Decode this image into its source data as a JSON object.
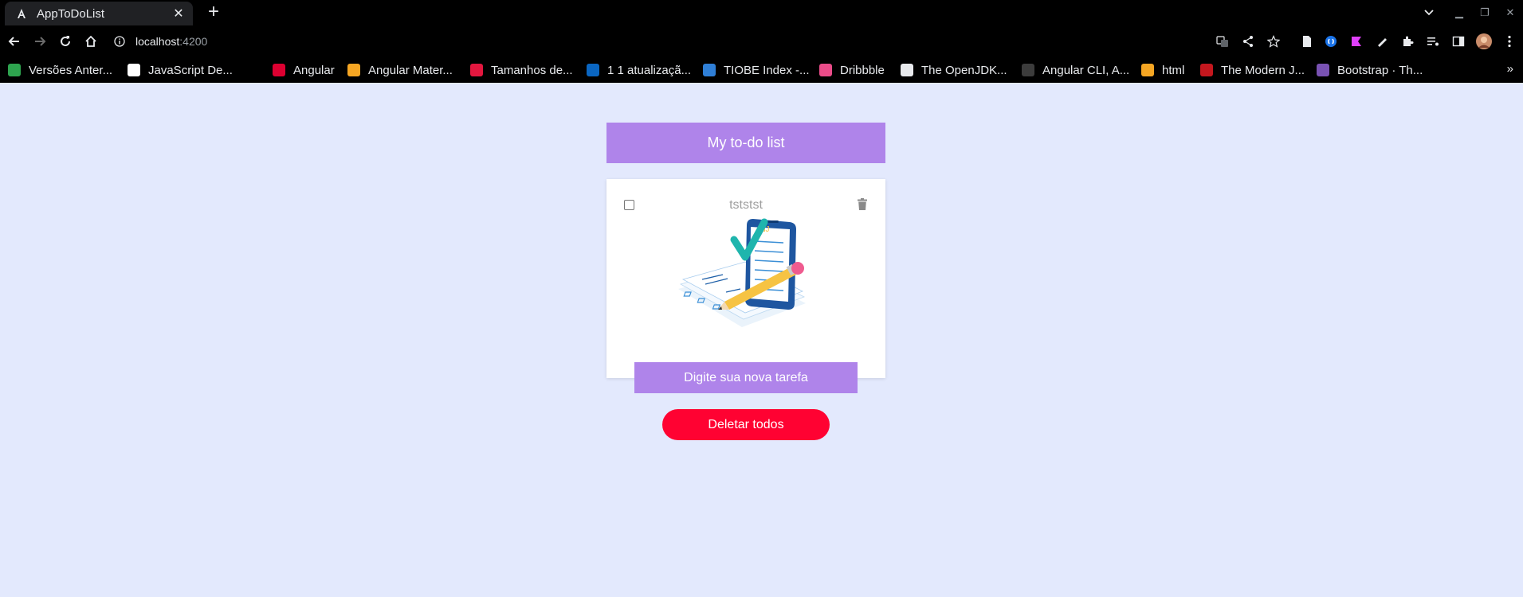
{
  "browser": {
    "tab_title": "AppToDoList",
    "tab_close": "✕",
    "new_tab": "+",
    "url_host": "localhost",
    "url_port": ":4200",
    "bookmarks": [
      {
        "label": "Versões Anter...",
        "icon_color": "#2ea44f"
      },
      {
        "label": "JavaScript De...",
        "icon_color": "#ffffff"
      },
      {
        "label": "Angular",
        "icon_color": "#dd0031"
      },
      {
        "label": "Angular Mater...",
        "icon_color": "#f6a623"
      },
      {
        "label": "Tamanhos de...",
        "icon_color": "#e3173f"
      },
      {
        "label": "1 1 atualizaçã...",
        "icon_color": "#0a66c2"
      },
      {
        "label": "TIOBE Index -...",
        "icon_color": "#2f7fd7"
      },
      {
        "label": "Dribbble",
        "icon_color": "#ea4c89"
      },
      {
        "label": "The OpenJDK...",
        "icon_color": "#e8eaed"
      },
      {
        "label": "Angular CLI, A...",
        "icon_color": "#3c3c3c"
      },
      {
        "label": "html",
        "icon_color": "#f5a623"
      },
      {
        "label": "The Modern J...",
        "icon_color": "#c4171e"
      },
      {
        "label": "Bootstrap · Th...",
        "icon_color": "#7952b3"
      }
    ],
    "bookmarks_more": "»"
  },
  "app": {
    "title": "My to-do list",
    "task": {
      "text": "tststst",
      "checked": false
    },
    "input_placeholder": "Digite sua nova tarefa",
    "delete_all_label": "Deletar todos"
  },
  "colors": {
    "page_bg": "#e3e9fd",
    "accent": "#af84ea",
    "danger": "#ff0232"
  }
}
